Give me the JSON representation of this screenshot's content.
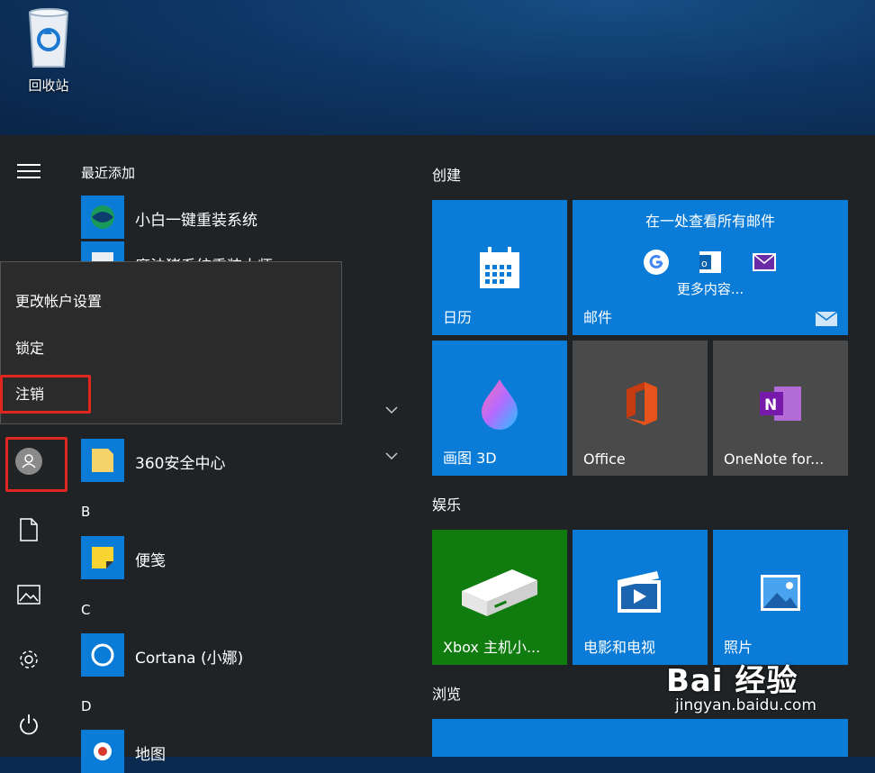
{
  "desktop": {
    "recycle_bin_label": "回收站"
  },
  "rail": {
    "icons": [
      "hamburger-menu-icon",
      "user-avatar-icon",
      "document-icon",
      "pictures-icon",
      "gear-icon",
      "power-icon"
    ]
  },
  "applist": {
    "recent_header": "最近添加",
    "recent_apps": [
      "小白一键重装系统",
      "魔法猪系统重装大师"
    ],
    "apps": [
      {
        "label": "360安全中心"
      },
      {
        "label": "便笺"
      },
      {
        "label": "Cortana (小娜)"
      },
      {
        "label": "地图"
      }
    ],
    "section_letters": [
      "B",
      "C",
      "D"
    ]
  },
  "account_menu": {
    "items": [
      "更改帐户设置",
      "锁定",
      "注销"
    ]
  },
  "tiles": {
    "group_create": "创建",
    "group_entertainment": "娱乐",
    "group_browse": "浏览",
    "calendar": "日历",
    "mail_title": "在一处查看所有邮件",
    "mail_more": "更多内容...",
    "mail": "邮件",
    "paint3d": "画图 3D",
    "office": "Office",
    "onenote": "OneNote for...",
    "xbox": "Xbox 主机小...",
    "movies": "电影和电视",
    "photos": "照片"
  },
  "watermark": {
    "brand": "Bai 经验",
    "url": "jingyan.baidu.com"
  },
  "colors": {
    "tile_blue": "#0a7cd8",
    "tile_gray": "#4a4a4a",
    "xbox_green": "#107c10",
    "highlight_red": "#e0261f",
    "start_bg": "#1f2326"
  }
}
